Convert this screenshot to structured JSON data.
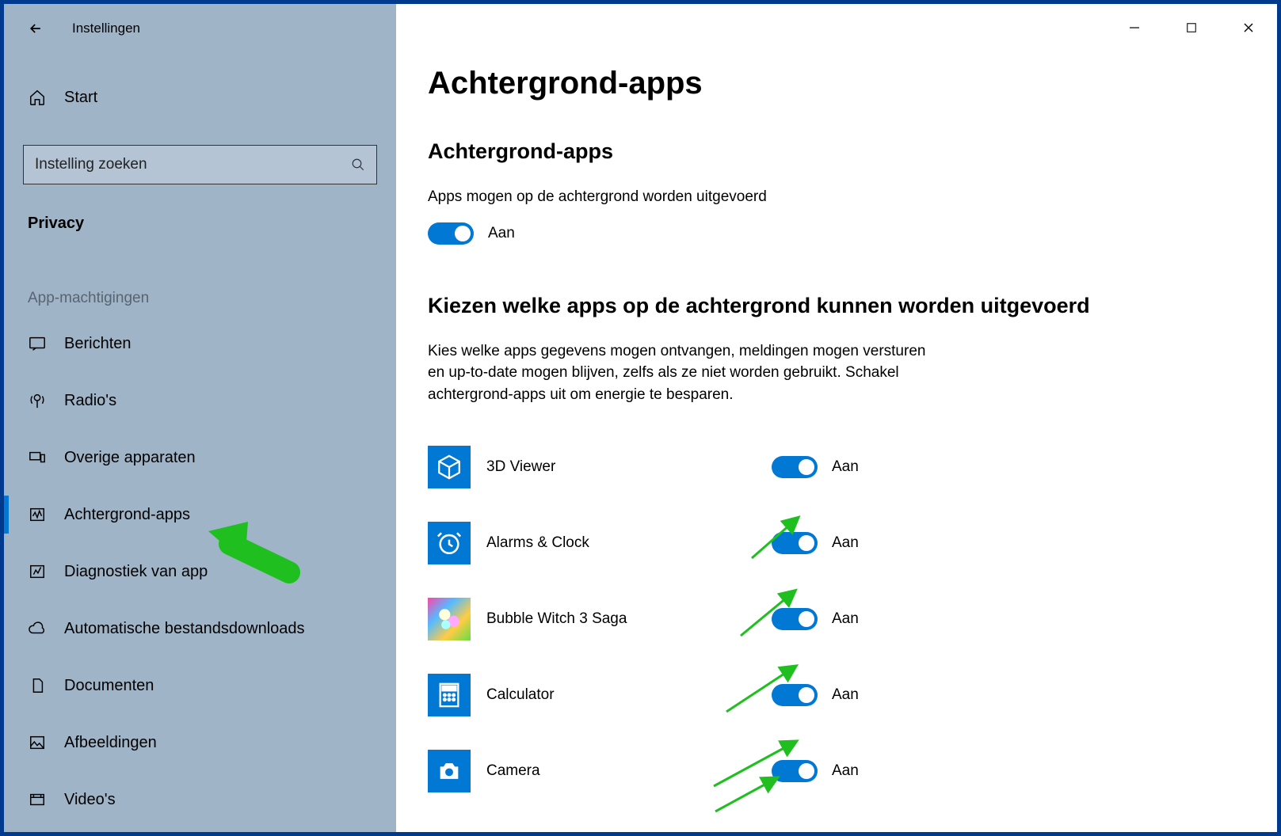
{
  "window": {
    "title": "Instellingen"
  },
  "sidebar": {
    "start_label": "Start",
    "search_placeholder": "Instelling zoeken",
    "privacy_label": "Privacy",
    "section_header": "App-machtigingen",
    "items": [
      {
        "label": "Berichten",
        "icon": "message",
        "active": false
      },
      {
        "label": "Radio's",
        "icon": "radio",
        "active": false
      },
      {
        "label": "Overige apparaten",
        "icon": "devices",
        "active": false
      },
      {
        "label": "Achtergrond-apps",
        "icon": "activity",
        "active": true
      },
      {
        "label": "Diagnostiek van app",
        "icon": "diagnostics",
        "active": false
      },
      {
        "label": "Automatische bestandsdownloads",
        "icon": "cloud",
        "active": false
      },
      {
        "label": "Documenten",
        "icon": "document",
        "active": false
      },
      {
        "label": "Afbeeldingen",
        "icon": "image",
        "active": false
      },
      {
        "label": "Video's",
        "icon": "video",
        "active": false
      }
    ]
  },
  "main": {
    "page_title": "Achtergrond-apps",
    "section1_title": "Achtergrond-apps",
    "section1_desc": "Apps mogen op de achtergrond worden uitgevoerd",
    "global_toggle_label": "Aan",
    "section2_title": "Kiezen welke apps op de achtergrond kunnen worden uitgevoerd",
    "section2_desc": "Kies welke apps gegevens mogen ontvangen, meldingen mogen versturen en up-to-date mogen blijven, zelfs als ze niet worden gebruikt. Schakel achtergrond-apps uit om energie te besparen.",
    "apps": [
      {
        "name": "3D Viewer",
        "state_label": "Aan",
        "icon": "cube"
      },
      {
        "name": "Alarms & Clock",
        "state_label": "Aan",
        "icon": "clock"
      },
      {
        "name": "Bubble Witch 3 Saga",
        "state_label": "Aan",
        "icon": "bubble"
      },
      {
        "name": "Calculator",
        "state_label": "Aan",
        "icon": "calculator"
      },
      {
        "name": "Camera",
        "state_label": "Aan",
        "icon": "camera"
      }
    ]
  }
}
